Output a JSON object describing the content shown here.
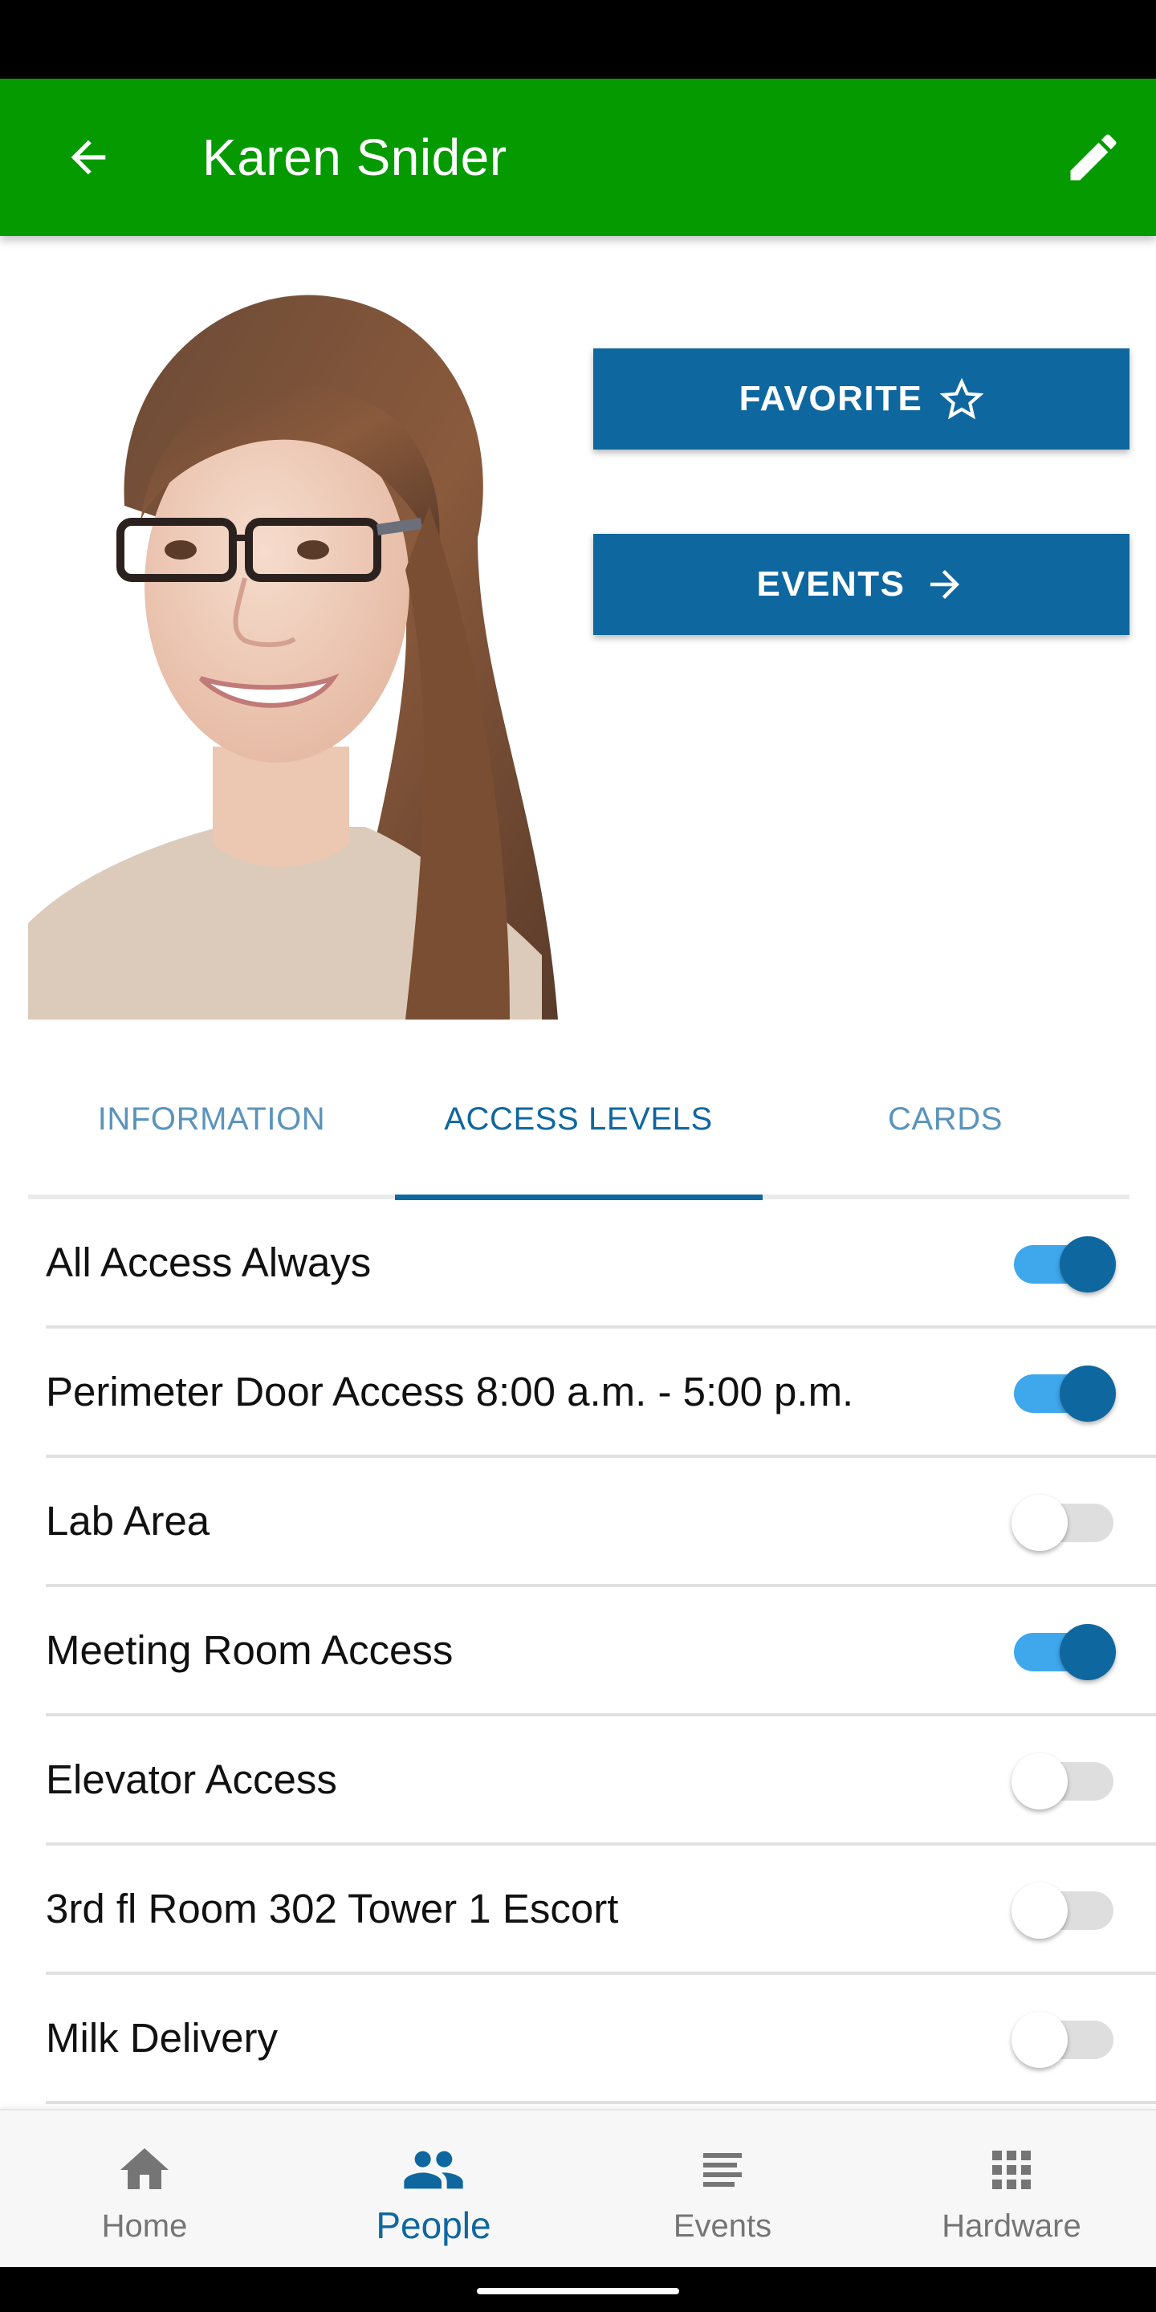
{
  "app_bar": {
    "title": "Karen Snider",
    "back_icon": "arrow-back-icon",
    "edit_icon": "pencil-edit-icon",
    "color": "#049a00"
  },
  "profile": {
    "photo_alt": "Portrait photo of Karen Snider"
  },
  "actions": {
    "favorite_label": "FAVORITE",
    "favorite_icon": "star-outline-icon",
    "events_label": "EVENTS",
    "events_icon": "arrow-forward-icon",
    "color": "#0f67a0"
  },
  "tabs": [
    {
      "label": "INFORMATION",
      "active": false
    },
    {
      "label": "ACCESS LEVELS",
      "active": true
    },
    {
      "label": "CARDS",
      "active": false
    }
  ],
  "access_levels": [
    {
      "label": "All Access Always",
      "enabled": true
    },
    {
      "label": "Perimeter Door Access 8:00 a.m. - 5:00 p.m.",
      "enabled": true
    },
    {
      "label": "Lab Area",
      "enabled": false
    },
    {
      "label": "Meeting Room Access",
      "enabled": true
    },
    {
      "label": "Elevator Access",
      "enabled": false
    },
    {
      "label": "3rd fl Room 302 Tower 1 Escort",
      "enabled": false
    },
    {
      "label": "Milk Delivery",
      "enabled": false
    }
  ],
  "bottom_nav": [
    {
      "label": "Home",
      "icon": "home-icon",
      "active": false
    },
    {
      "label": "People",
      "icon": "people-icon",
      "active": true
    },
    {
      "label": "Events",
      "icon": "list-icon",
      "active": false
    },
    {
      "label": "Hardware",
      "icon": "grid-icon",
      "active": false
    }
  ],
  "colors": {
    "accent": "#0f67a0",
    "switch_track_on": "#3fa7ec",
    "switch_track_off": "#dedede",
    "nav_inactive": "#757575"
  }
}
